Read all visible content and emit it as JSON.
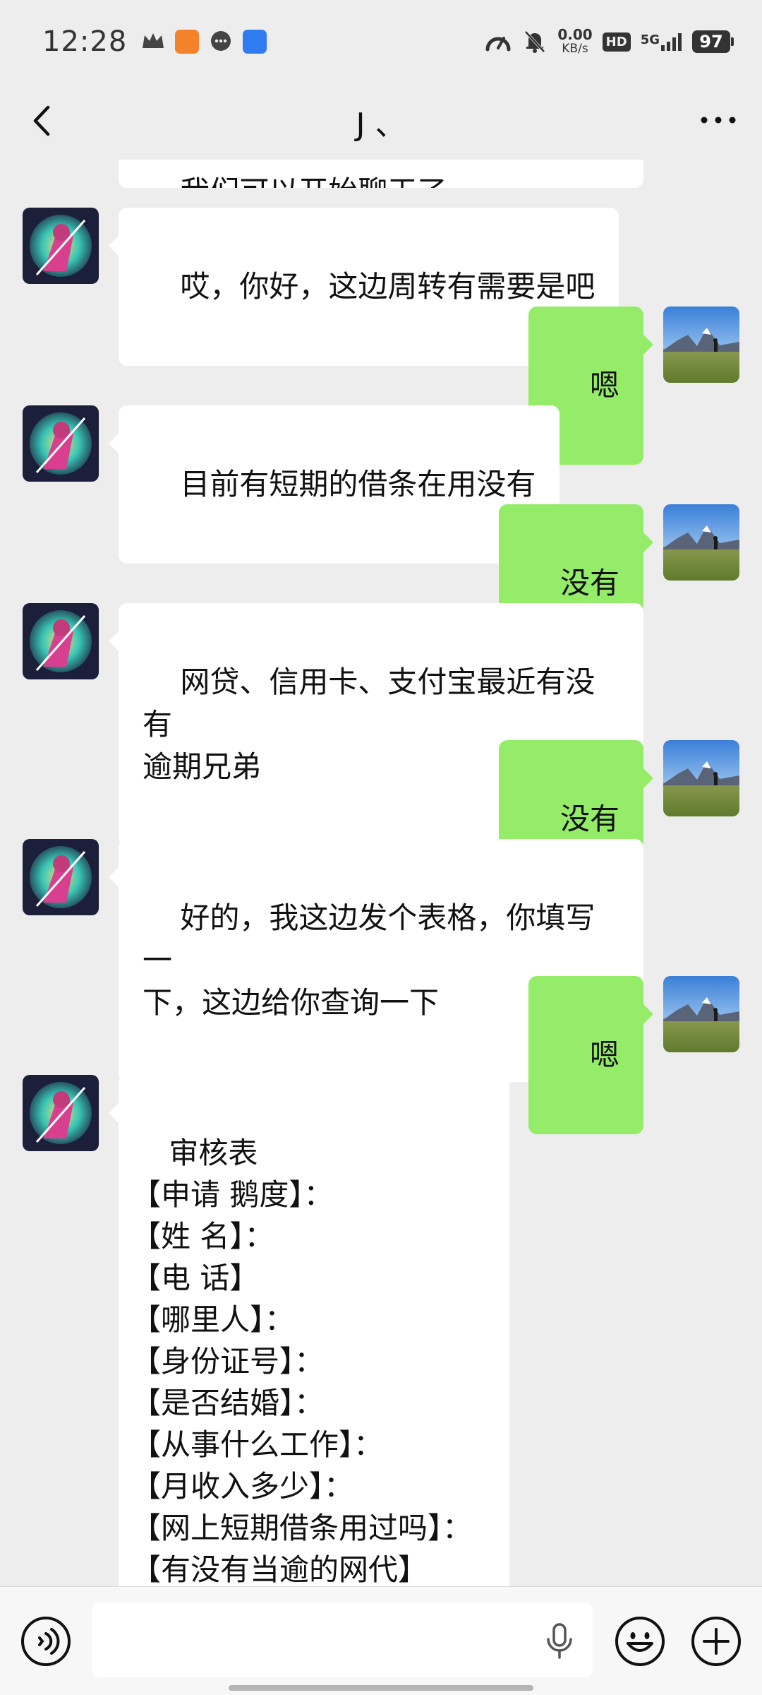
{
  "status_bar": {
    "time": "12:28",
    "net_speed_value": "0.00",
    "net_speed_unit": "KB/s",
    "hd_label": "HD",
    "signal_label": "5G",
    "battery": "97"
  },
  "header": {
    "title": "J 、"
  },
  "messages": [
    {
      "side": "in",
      "text": "我们可以开始聊天了"
    },
    {
      "side": "in",
      "text": "哎，你好，这边周转有需要是吧"
    },
    {
      "side": "out",
      "text": "嗯"
    },
    {
      "side": "in",
      "text": "目前有短期的借条在用没有"
    },
    {
      "side": "out",
      "text": "没有"
    },
    {
      "side": "in",
      "text": "网贷、信用卡、支付宝最近有没有\n逾期兄弟"
    },
    {
      "side": "out",
      "text": "没有"
    },
    {
      "side": "in",
      "text": "好的，我这边发个表格，你填写一\n下，这边给你查询一下"
    },
    {
      "side": "out",
      "text": "嗯"
    },
    {
      "side": "in",
      "text": "审核表\n【申请 鹅度】：\n【姓 名】：\n【电 话】\n【哪里人】：\n【身份证号】：\n【是否结婚】：\n【从事什么工作】：\n【月收入多少】：\n【网上短期借条用过吗】：\n【有没有当逾的网代】"
    }
  ],
  "colors": {
    "background": "#ededed",
    "incoming_bubble": "#ffffff",
    "outgoing_bubble": "#95ec69",
    "input_bar": "#f7f7f7"
  },
  "icons": {
    "back": "chevron-left-icon",
    "more": "more-dots-icon",
    "voice": "voice-icon",
    "mic": "microphone-icon",
    "emoji": "emoji-icon",
    "plus": "plus-icon"
  }
}
